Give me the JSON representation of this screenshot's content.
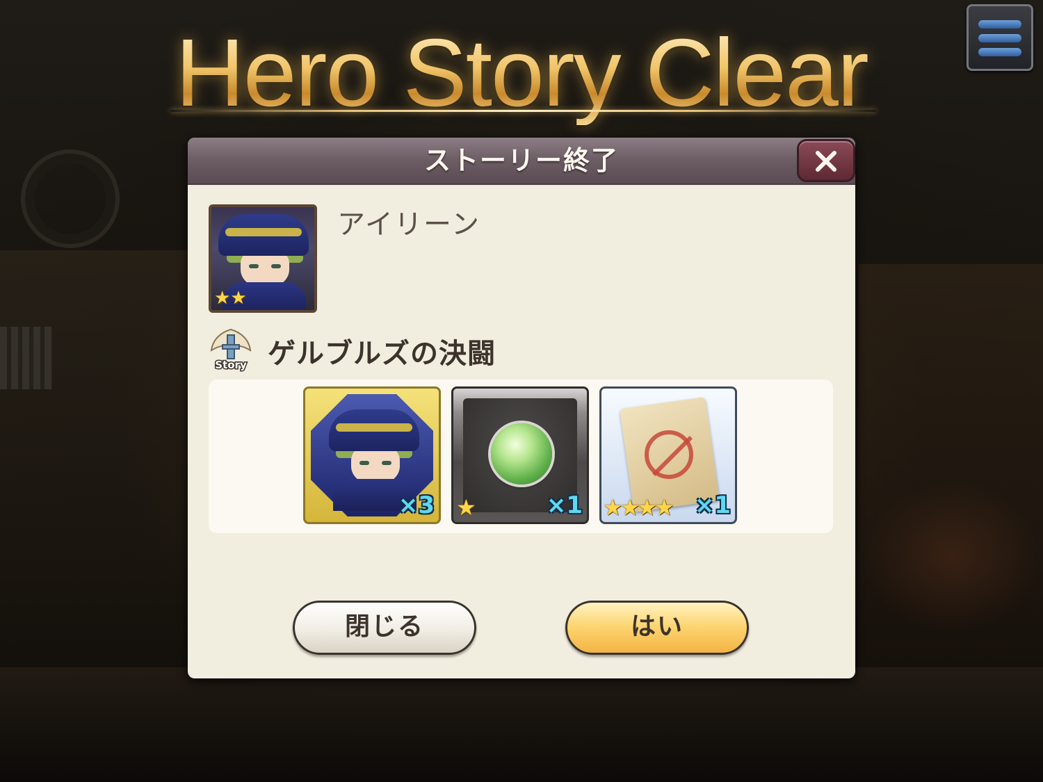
{
  "banner": {
    "title": "Hero Story Clear"
  },
  "menu": {
    "icon": "hamburger-menu-icon"
  },
  "dialog": {
    "title": "ストーリー終了",
    "close_icon": "close-x-icon",
    "hero": {
      "name": "アイリーン",
      "rarity_stars": 2,
      "stars_text": "★★"
    },
    "story": {
      "icon": "story-badge-icon",
      "icon_label": "Story",
      "title": "ゲルブルズの決闘"
    },
    "rewards": [
      {
        "kind": "hero-portrait",
        "quantity": "×3",
        "stars_text": ""
      },
      {
        "kind": "green-orb",
        "quantity": "×1",
        "stars_text": "★"
      },
      {
        "kind": "scroll",
        "quantity": "×1",
        "stars_text": "★★★★"
      }
    ],
    "buttons": {
      "close": "閉じる",
      "yes": "はい"
    }
  },
  "colors": {
    "title_gold": "#f1c56a",
    "header": "#6c5c64",
    "panel": "#f1eedf",
    "yes_button": "#fcd36e",
    "quantity_text": "#5fd8f0"
  }
}
